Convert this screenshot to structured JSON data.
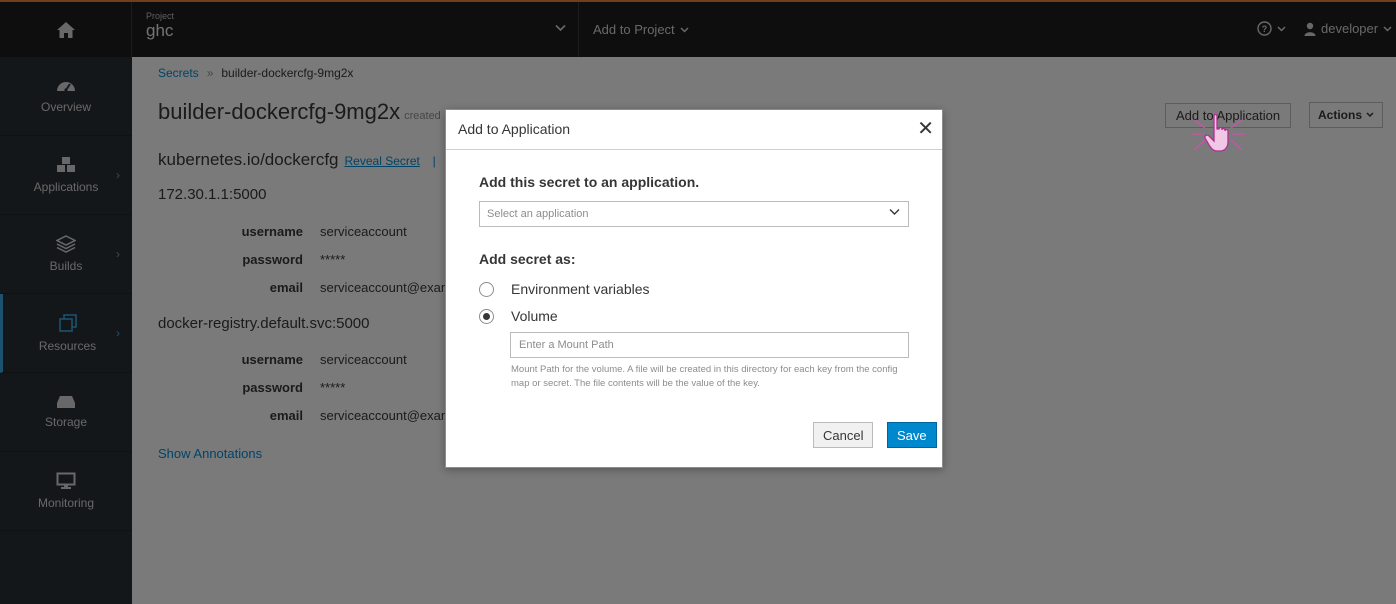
{
  "topbar": {
    "project_label": "Project",
    "project_name": "ghc",
    "add_to_project": "Add to Project",
    "help_icon": "question-circle-icon",
    "user_name": "developer"
  },
  "sidebar": {
    "items": [
      {
        "label": "Overview",
        "icon": "dashboard-icon"
      },
      {
        "label": "Applications",
        "icon": "cubes-icon"
      },
      {
        "label": "Builds",
        "icon": "layers-icon"
      },
      {
        "label": "Resources",
        "icon": "resources-icon"
      },
      {
        "label": "Storage",
        "icon": "hdd-icon"
      },
      {
        "label": "Monitoring",
        "icon": "monitor-icon"
      }
    ]
  },
  "breadcrumb": {
    "parent": "Secrets",
    "current": "builder-dockercfg-9mg2x"
  },
  "page": {
    "title": "builder-dockercfg-9mg2x",
    "created_prefix": "created",
    "add_to_app_button": "Add to Application",
    "actions_button": "Actions",
    "secret_type": "kubernetes.io/dockercfg",
    "reveal_secret": "Reveal Secret",
    "reveal_sep": "|",
    "registries": [
      {
        "host": "172.30.1.1:5000",
        "username_label": "username",
        "username": "serviceaccount",
        "password_label": "password",
        "password": "*****",
        "email_label": "email",
        "email": "serviceaccount@examp"
      },
      {
        "host": "docker-registry.default.svc:5000",
        "username_label": "username",
        "username": "serviceaccount",
        "password_label": "password",
        "password": "*****",
        "email_label": "email",
        "email": "serviceaccount@examp"
      }
    ],
    "show_annotations": "Show Annotations"
  },
  "modal": {
    "title": "Add to Application",
    "close": "✕",
    "heading": "Add this secret to an application.",
    "select_placeholder": "Select an application",
    "add_as_heading": "Add secret as:",
    "option_env": "Environment variables",
    "option_volume": "Volume",
    "selected_option": "Volume",
    "mount_placeholder": "Enter a Mount Path",
    "mount_help": "Mount Path for the volume. A file will be created in this directory for each key from the config map or secret. The file contents will be the value of the key.",
    "cancel": "Cancel",
    "save": "Save"
  },
  "colors": {
    "topbar_bg": "#1d1d1d",
    "sidebar_bg": "#292e34",
    "accent_blue": "#0088ce",
    "active_indicator": "#39a5dc",
    "top_border": "#e07c3a"
  }
}
